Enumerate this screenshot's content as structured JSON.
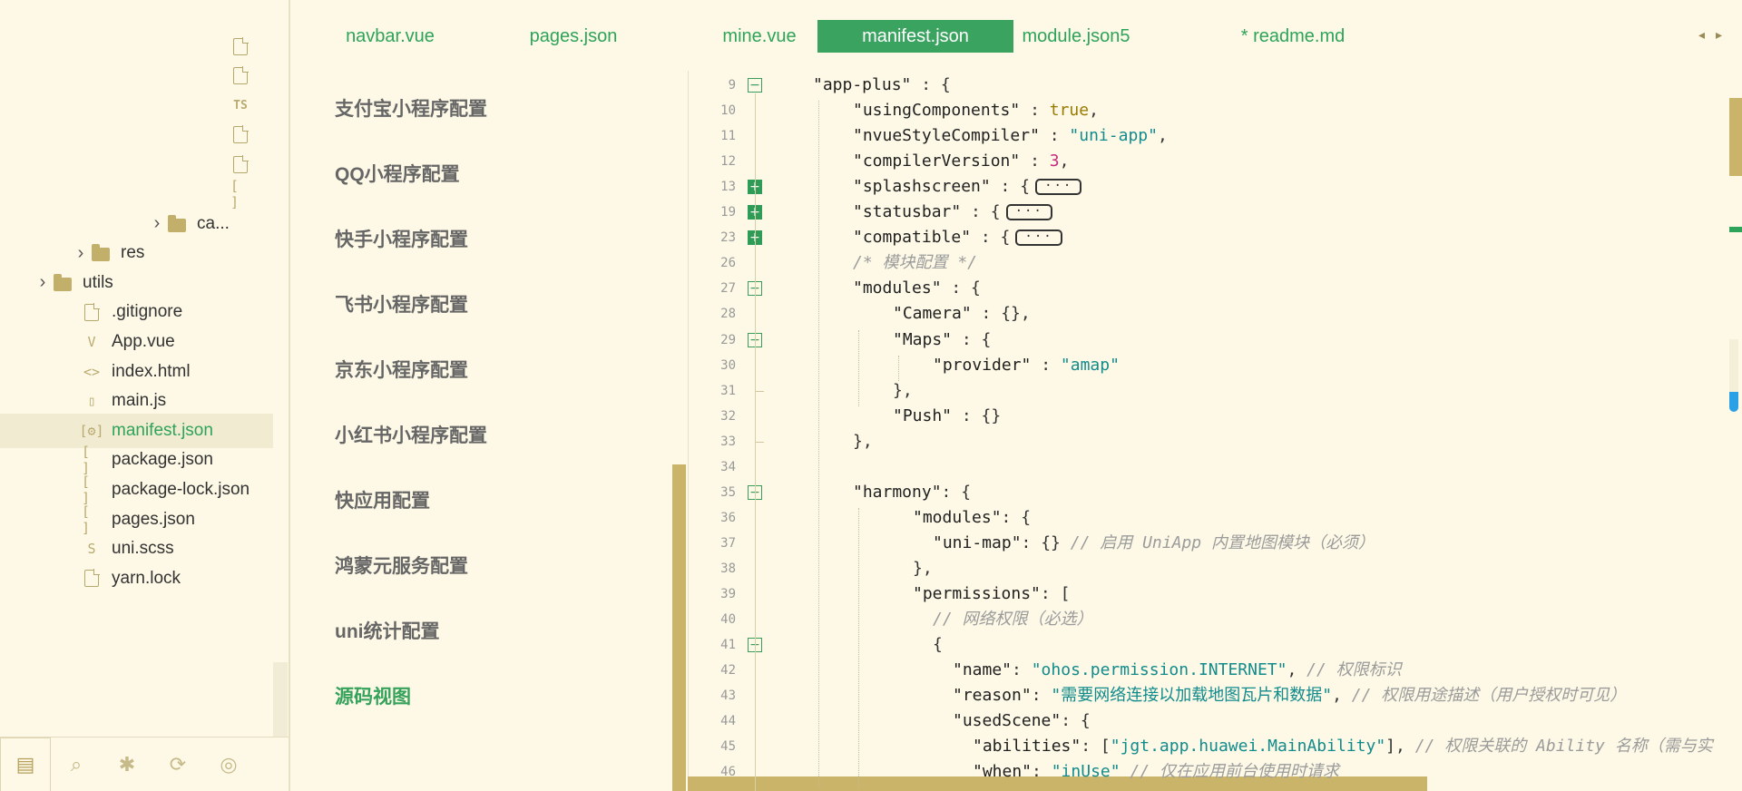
{
  "explorer": {
    "rows": [
      {
        "label": "",
        "icon": "file-icon",
        "kind": "file",
        "indent": 254
      },
      {
        "label": "",
        "icon": "file-icon",
        "kind": "file",
        "indent": 254
      },
      {
        "label": "",
        "icon": "ts-file-icon",
        "kind": "ts",
        "glyph": "TS",
        "indent": 254
      },
      {
        "label": "",
        "icon": "file-icon",
        "kind": "file",
        "indent": 254
      },
      {
        "label": "",
        "icon": "file-icon",
        "kind": "file",
        "indent": 254
      },
      {
        "label": "",
        "icon": "json-file-icon",
        "kind": "json",
        "glyph": "[ ]",
        "indent": 254
      },
      {
        "label": "ca...",
        "icon": "folder-icon",
        "kind": "folder",
        "chevron": "›",
        "indent": 184
      },
      {
        "label": "res",
        "icon": "folder-icon",
        "kind": "folder",
        "chevron": "›",
        "indent": 100
      },
      {
        "label": "utils",
        "icon": "folder-icon",
        "kind": "folder",
        "chevron": "›",
        "indent": 58
      },
      {
        "label": ".gitignore",
        "icon": "file-icon",
        "kind": "file",
        "indent": 90
      },
      {
        "label": "App.vue",
        "icon": "vue-file-icon",
        "kind": "vue",
        "glyph": "V",
        "indent": 90
      },
      {
        "label": "index.html",
        "icon": "html-file-icon",
        "kind": "html",
        "glyph": "<>",
        "indent": 90
      },
      {
        "label": "main.js",
        "icon": "js-file-icon",
        "kind": "js",
        "glyph": "▯",
        "indent": 90
      },
      {
        "label": "manifest.json",
        "icon": "manifest-file-icon",
        "kind": "manifest",
        "glyph": "[⚙]",
        "indent": 90,
        "selected": true
      },
      {
        "label": "package.json",
        "icon": "json-file-icon",
        "kind": "json",
        "glyph": "[ ]",
        "indent": 90
      },
      {
        "label": "package-lock.json",
        "icon": "json-file-icon",
        "kind": "json",
        "glyph": "[ ]",
        "indent": 90
      },
      {
        "label": "pages.json",
        "icon": "json-file-icon",
        "kind": "json",
        "glyph": "[ ]",
        "indent": 90
      },
      {
        "label": "uni.scss",
        "icon": "scss-file-icon",
        "kind": "scss",
        "glyph": "S",
        "indent": 90
      },
      {
        "label": "yarn.lock",
        "icon": "file-icon",
        "kind": "file",
        "indent": 90
      }
    ],
    "toolbar": [
      {
        "name": "explorer-tool-button",
        "icon": "files-icon",
        "glyph": "▤",
        "active": true
      },
      {
        "name": "search-tool-button",
        "icon": "binoculars-icon",
        "glyph": "⌕"
      },
      {
        "name": "debug-tool-button",
        "icon": "bug-icon",
        "glyph": "✱"
      },
      {
        "name": "git-tool-button",
        "icon": "git-icon",
        "glyph": "⟳"
      },
      {
        "name": "web-tool-button",
        "icon": "globe-icon",
        "glyph": "◎"
      }
    ]
  },
  "tabs": [
    {
      "label": "navbar.vue"
    },
    {
      "label": "pages.json"
    },
    {
      "label": "mine.vue"
    },
    {
      "label": "manifest.json",
      "active": true
    },
    {
      "label": "module.json5"
    },
    {
      "label": "* readme.md"
    }
  ],
  "tab_nav": {
    "prev": "◂",
    "next": "▸"
  },
  "config_nav": [
    {
      "label": "支付宝小程序配置"
    },
    {
      "label": "QQ小程序配置"
    },
    {
      "label": "快手小程序配置"
    },
    {
      "label": "飞书小程序配置"
    },
    {
      "label": "京东小程序配置"
    },
    {
      "label": "小红书小程序配置"
    },
    {
      "label": "快应用配置"
    },
    {
      "label": "鸿蒙元服务配置"
    },
    {
      "label": "uni统计配置"
    },
    {
      "label": "源码视图",
      "active": true
    }
  ],
  "editor": {
    "lines": [
      {
        "no": "9",
        "fold": "minus",
        "indent": 0,
        "tokens": [
          [
            "s-key",
            "\"app-plus\""
          ],
          [
            "p",
            " : {"
          ]
        ]
      },
      {
        "no": "10",
        "indent": 1,
        "tokens": [
          [
            "s-key",
            "\"usingComponents\""
          ],
          [
            "p",
            " : "
          ],
          [
            "b",
            "true"
          ],
          [
            "p",
            ","
          ]
        ]
      },
      {
        "no": "11",
        "indent": 1,
        "tokens": [
          [
            "s-key",
            "\"nvueStyleCompiler\""
          ],
          [
            "p",
            " : "
          ],
          [
            "s",
            "\"uni-app\""
          ],
          [
            "p",
            ","
          ]
        ]
      },
      {
        "no": "12",
        "indent": 1,
        "tokens": [
          [
            "s-key",
            "\"compilerVersion\""
          ],
          [
            "p",
            " : "
          ],
          [
            "n",
            "3"
          ],
          [
            "p",
            ","
          ]
        ]
      },
      {
        "no": "13",
        "fold": "plus",
        "indent": 1,
        "tokens": [
          [
            "s-key",
            "\"splashscreen\""
          ],
          [
            "p",
            " : {"
          ]
        ],
        "collapsed": true
      },
      {
        "no": "19",
        "fold": "plus",
        "indent": 1,
        "tokens": [
          [
            "s-key",
            "\"statusbar\""
          ],
          [
            "p",
            " : {"
          ]
        ],
        "collapsed": true
      },
      {
        "no": "23",
        "fold": "plus",
        "indent": 1,
        "tokens": [
          [
            "s-key",
            "\"compatible\""
          ],
          [
            "p",
            " : {"
          ]
        ],
        "collapsed": true
      },
      {
        "no": "26",
        "indent": 1,
        "tokens": [
          [
            "c",
            "/* 模块配置 */"
          ]
        ]
      },
      {
        "no": "27",
        "fold": "minus",
        "indent": 1,
        "tokens": [
          [
            "s-key",
            "\"modules\""
          ],
          [
            "p",
            " : {"
          ]
        ]
      },
      {
        "no": "28",
        "indent": 2,
        "tokens": [
          [
            "s-key",
            "\"Camera\""
          ],
          [
            "p",
            " : {},"
          ]
        ]
      },
      {
        "no": "29",
        "fold": "minus",
        "indent": 2,
        "tokens": [
          [
            "s-key",
            "\"Maps\""
          ],
          [
            "p",
            " : {"
          ]
        ]
      },
      {
        "no": "30",
        "indent": 3,
        "tokens": [
          [
            "s-key",
            "\"provider\""
          ],
          [
            "p",
            " : "
          ],
          [
            "s",
            "\"amap\""
          ]
        ]
      },
      {
        "no": "31",
        "fold": "end",
        "indent": 2,
        "tokens": [
          [
            "p",
            "},"
          ]
        ]
      },
      {
        "no": "32",
        "indent": 2,
        "tokens": [
          [
            "s-key",
            "\"Push\""
          ],
          [
            "p",
            " : {}"
          ]
        ]
      },
      {
        "no": "33",
        "fold": "end",
        "indent": 1,
        "tokens": [
          [
            "p",
            "},"
          ]
        ]
      },
      {
        "no": "34",
        "indent": 0,
        "tokens": []
      },
      {
        "no": "35",
        "fold": "minus",
        "indent": 1,
        "tokens": [
          [
            "s-key",
            "\"harmony\""
          ],
          [
            "p",
            ": {"
          ]
        ]
      },
      {
        "no": "36",
        "indent": 2.5,
        "tokens": [
          [
            "s-key",
            "\"modules\""
          ],
          [
            "p",
            ": {"
          ]
        ]
      },
      {
        "no": "37",
        "indent": 3,
        "tokens": [
          [
            "s-key",
            "\"uni-map\""
          ],
          [
            "p",
            ": {} "
          ],
          [
            "c",
            "// 启用 UniApp 内置地图模块（必须）"
          ]
        ]
      },
      {
        "no": "38",
        "indent": 2.5,
        "tokens": [
          [
            "p",
            "},"
          ]
        ]
      },
      {
        "no": "39",
        "indent": 2.5,
        "tokens": [
          [
            "s-key",
            "\"permissions\""
          ],
          [
            "p",
            ": ["
          ]
        ]
      },
      {
        "no": "40",
        "indent": 3,
        "tokens": [
          [
            "c",
            "// 网络权限（必选）"
          ]
        ]
      },
      {
        "no": "41",
        "fold": "minus",
        "indent": 3,
        "tokens": [
          [
            "p",
            "{"
          ]
        ]
      },
      {
        "no": "42",
        "indent": 3.5,
        "tokens": [
          [
            "s-key",
            "\"name\""
          ],
          [
            "p",
            ": "
          ],
          [
            "s",
            "\"ohos.permission.INTERNET\""
          ],
          [
            "p",
            ", "
          ],
          [
            "c",
            "// 权限标识"
          ]
        ]
      },
      {
        "no": "43",
        "indent": 3.5,
        "tokens": [
          [
            "s-key",
            "\"reason\""
          ],
          [
            "p",
            ": "
          ],
          [
            "s",
            "\"需要网络连接以加载地图瓦片和数据\""
          ],
          [
            "p",
            ", "
          ],
          [
            "c",
            "// 权限用途描述（用户授权时可见）"
          ]
        ]
      },
      {
        "no": "44",
        "indent": 3.5,
        "tokens": [
          [
            "s-key",
            "\"usedScene\""
          ],
          [
            "p",
            ": {"
          ]
        ]
      },
      {
        "no": "45",
        "indent": 4,
        "tokens": [
          [
            "s-key",
            "\"abilities\""
          ],
          [
            "p",
            ": ["
          ],
          [
            "s",
            "\"jgt.app.huawei.MainAbility\""
          ],
          [
            "p",
            "], "
          ],
          [
            "c",
            "// 权限关联的 Ability 名称（需与实"
          ]
        ]
      },
      {
        "no": "46",
        "indent": 4,
        "tokens": [
          [
            "s-key",
            "\"when\""
          ],
          [
            "p",
            ": "
          ],
          [
            "s",
            "\"inUse\""
          ],
          [
            "p",
            " "
          ],
          [
            "c",
            "// 仅在应用前台使用时请求"
          ]
        ]
      }
    ],
    "collapsed_label": "···"
  }
}
